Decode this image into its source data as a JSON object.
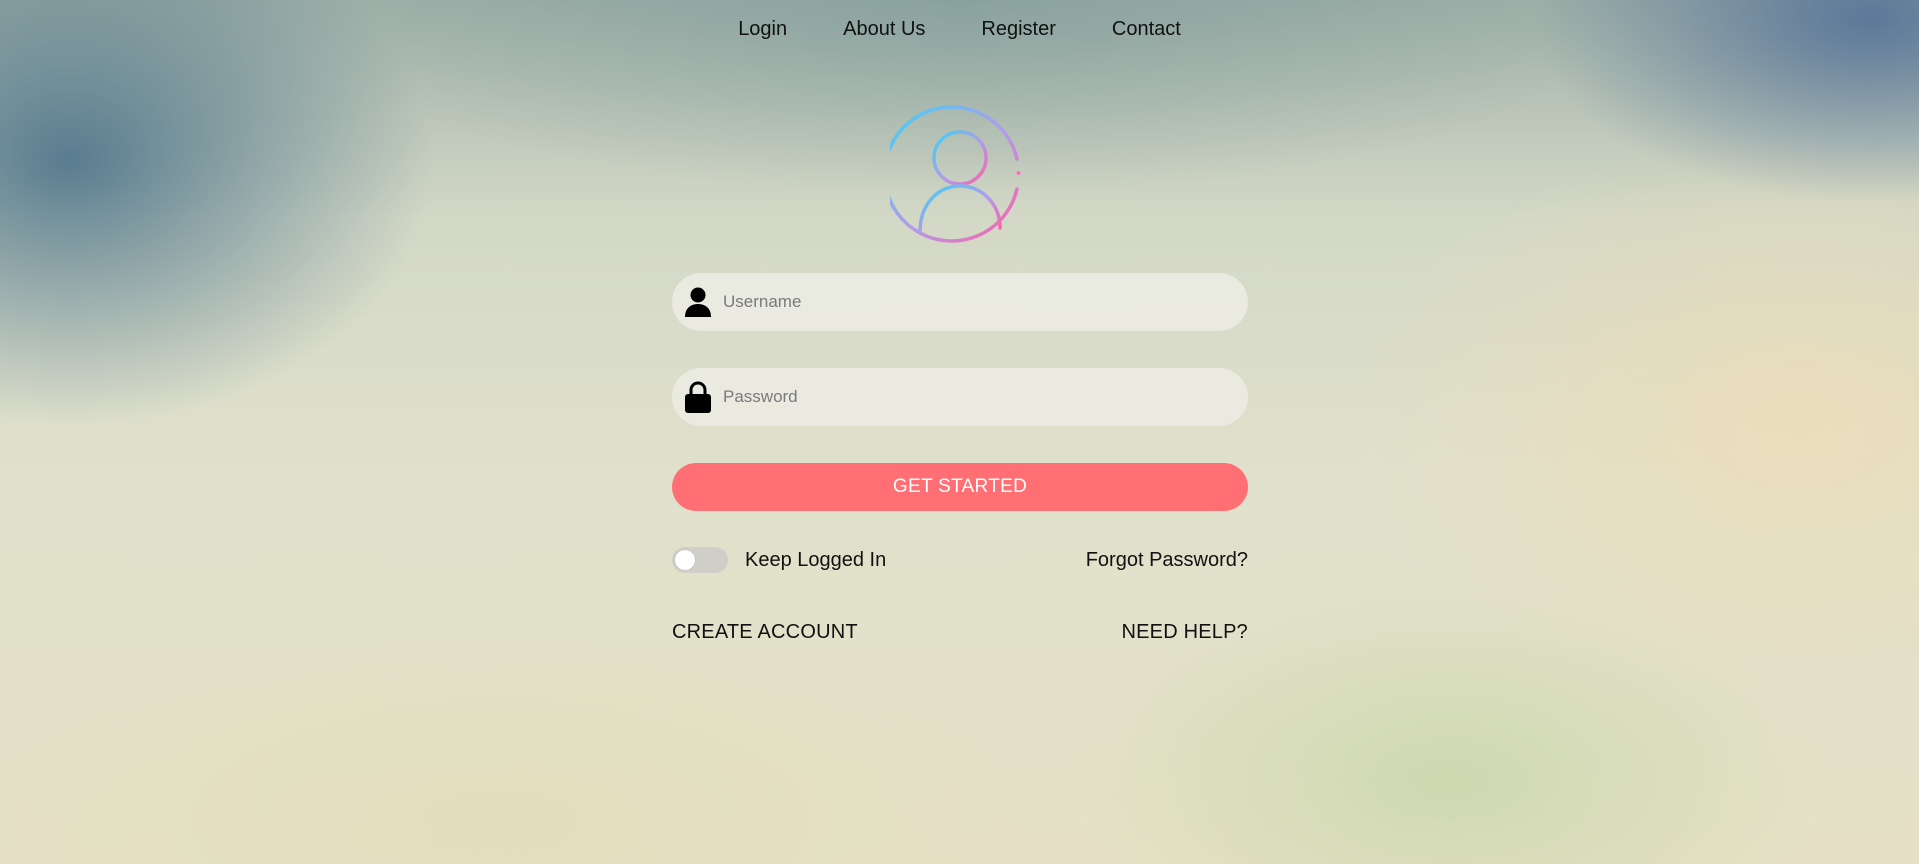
{
  "nav": {
    "items": [
      {
        "label": "Login"
      },
      {
        "label": "About Us"
      },
      {
        "label": "Register"
      },
      {
        "label": "Contact"
      }
    ]
  },
  "avatar": {
    "icon": "user-circle-icon",
    "gradient": [
      "#3ad3f5",
      "#b39bea",
      "#ff6fb8"
    ]
  },
  "form": {
    "username": {
      "icon": "user-icon",
      "placeholder": "Username",
      "value": ""
    },
    "password": {
      "icon": "lock-icon",
      "placeholder": "Password",
      "value": ""
    },
    "submit_label": "GET STARTED",
    "keep_logged_in": {
      "label": "Keep Logged In",
      "checked": false
    },
    "forgot_password": "Forgot Password?",
    "create_account": "CREATE ACCOUNT",
    "need_help": "NEED HELP?"
  },
  "colors": {
    "accent": "#ff6f73",
    "field_bg": "#ececE2",
    "text": "#111111"
  }
}
